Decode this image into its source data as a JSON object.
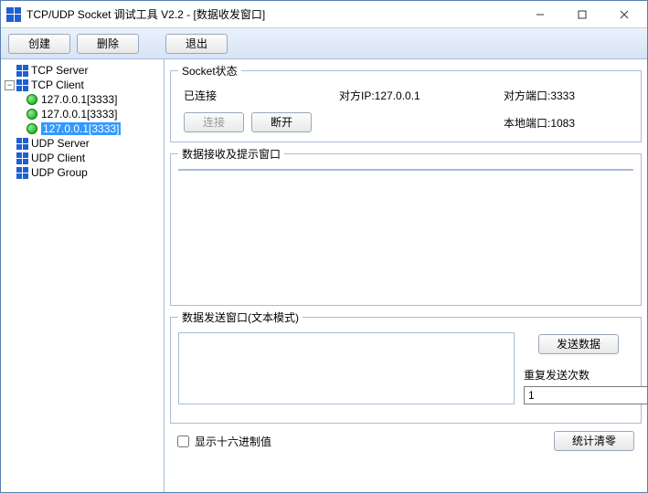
{
  "window": {
    "title": "TCP/UDP Socket 调试工具 V2.2 - [数据收发窗口]"
  },
  "toolbar": {
    "create": "创建",
    "delete": "删除",
    "exit": "退出"
  },
  "tree": {
    "tcp_server": "TCP Server",
    "tcp_client": "TCP Client",
    "clients": [
      "127.0.0.1[3333]",
      "127.0.0.1[3333]",
      "127.0.0.1[3333]"
    ],
    "udp_server": "UDP Server",
    "udp_client": "UDP Client",
    "udp_group": "UDP Group"
  },
  "status": {
    "legend": "Socket状态",
    "state": "已连接",
    "peer_ip_label": "对方IP:127.0.0.1",
    "peer_port_label": "对方端口:3333",
    "connect": "连接",
    "disconnect": "断开",
    "local_port_label": "本地端口:1083"
  },
  "recv": {
    "legend": "数据接收及提示窗口"
  },
  "send": {
    "legend": "数据发送窗口(文本模式)",
    "send_btn": "发送数据",
    "repeat_label": "重复发送次数",
    "repeat_value": "1"
  },
  "bottom": {
    "hex_label": "显示十六进制值",
    "clear_stats": "统计清零"
  }
}
